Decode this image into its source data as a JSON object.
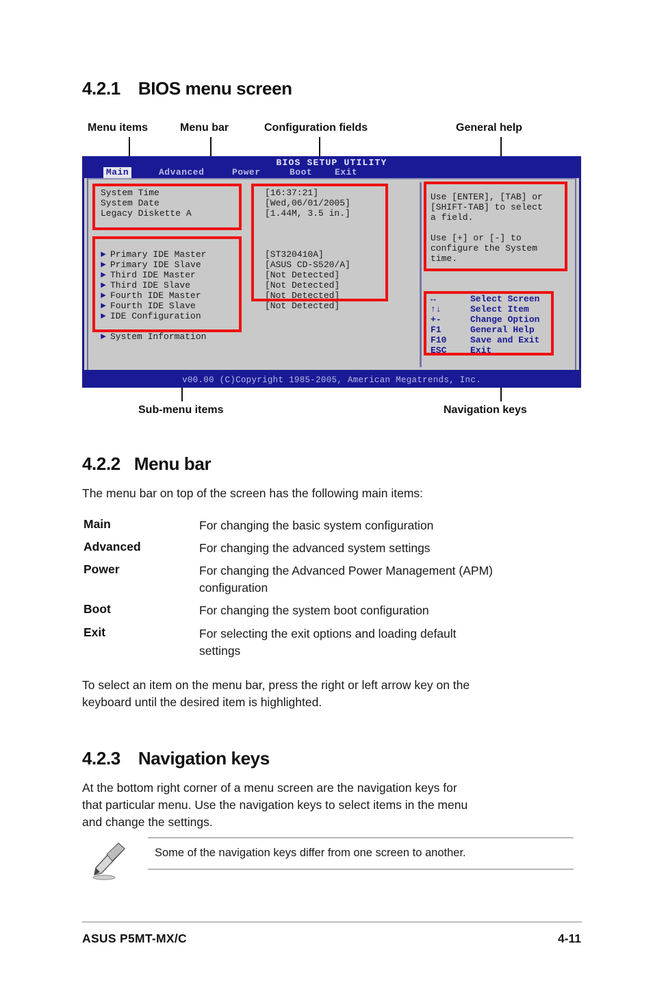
{
  "sections": {
    "s421": {
      "number": "4.2.1",
      "title": "BIOS menu screen"
    },
    "s422": {
      "number": "4.2.2",
      "title": "Menu bar"
    },
    "s423": {
      "number": "4.2.3",
      "title": "Navigation keys"
    }
  },
  "annotations": {
    "menu_items": "Menu items",
    "menu_bar": "Menu bar",
    "configuration_fields": "Configuration fields",
    "general_help": "General help",
    "sub_menu_items": "Sub-menu items",
    "navigation_keys": "Navigation keys"
  },
  "bios": {
    "title": "BIOS SETUP UTILITY",
    "menu_bar": [
      {
        "label": "Main",
        "active": true
      },
      {
        "label": "Advanced",
        "active": false
      },
      {
        "label": "Power",
        "active": false
      },
      {
        "label": "Boot",
        "active": false
      },
      {
        "label": "Exit",
        "active": false
      }
    ],
    "menu_items": [
      "System Time",
      "System Date",
      "Legacy Diskette A"
    ],
    "config_fields": [
      "[16:37:21]",
      "[Wed,06/01/2005]",
      "[1.44M, 3.5 in.]"
    ],
    "submenu_items": [
      "Primary IDE Master",
      "Primary IDE Slave",
      "Third IDE Master",
      "Third IDE Slave",
      "Fourth IDE Master",
      "Fourth IDE Slave",
      "IDE Configuration"
    ],
    "submenu_extra": "System Information",
    "submenu_values": [
      "[ST320410A]",
      "[ASUS CD-S520/A]",
      "[Not Detected]",
      "[Not Detected]",
      "[Not Detected]",
      "[Not Detected]"
    ],
    "general_help": [
      "Use [ENTER], [TAB] or",
      "[SHIFT-TAB] to select",
      "a field.",
      "",
      "Use [+] or [-] to",
      "configure the System",
      "time."
    ],
    "navigation_keys": [
      {
        "key": "↔",
        "desc": "Select Screen"
      },
      {
        "key": "↑↓",
        "desc": "Select Item"
      },
      {
        "key": "+-",
        "desc": "Change Option"
      },
      {
        "key": "F1",
        "desc": "General Help"
      },
      {
        "key": "F10",
        "desc": "Save and Exit"
      },
      {
        "key": "ESC",
        "desc": "Exit"
      }
    ],
    "copyright": "v00.00 (C)Copyright 1985-2005, American Megatrends, Inc."
  },
  "menu_bar_intro": "The menu bar on top of the screen has the following main items:",
  "menu_bar_entries": [
    {
      "term": "Main",
      "desc": "For changing the basic system configuration"
    },
    {
      "term": "Advanced",
      "desc": "For changing the advanced system settings"
    },
    {
      "term": "Power",
      "desc": "For changing the Advanced Power Management (APM)\nconfiguration"
    },
    {
      "term": "Boot",
      "desc": "For changing the system boot configuration"
    },
    {
      "term": "Exit",
      "desc": "For selecting the exit options and loading default\nsettings"
    }
  ],
  "menu_bar_outro": "To select an item on the menu bar, press the right or left arrow key on the\nkeyboard until the desired item is highlighted.",
  "nav_keys_paragraph": "At the bottom right corner of a menu screen are the navigation keys for\nthat particular menu. Use the navigation keys to select items in the menu\nand change the settings.",
  "note_text": "Some of the navigation keys differ from one screen to another.",
  "footer": {
    "left": "ASUS P5MT-MX/C",
    "right": "4-11"
  },
  "colors": {
    "bios_blue": "#1a1a96",
    "bios_gray": "#c9c9c9",
    "highlight_red": "#ee1111"
  }
}
